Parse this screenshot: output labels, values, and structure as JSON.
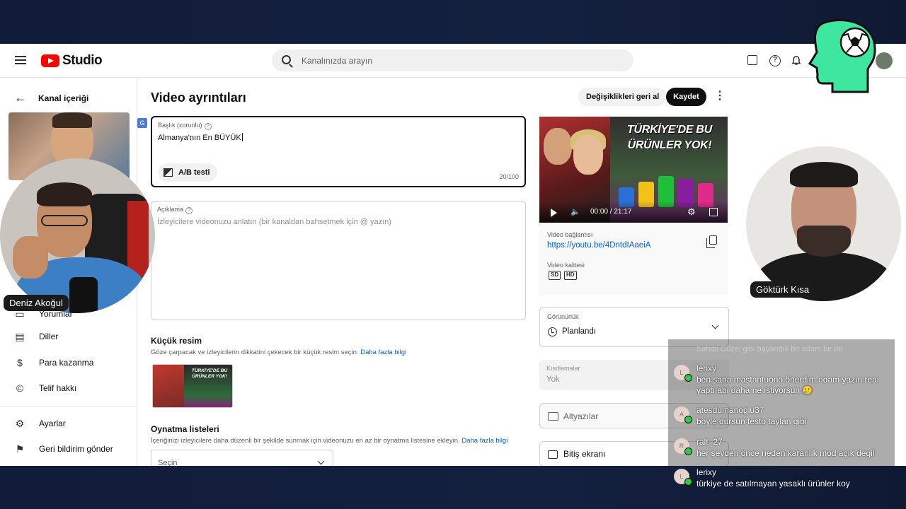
{
  "header": {
    "logo_text": "Studio",
    "search_placeholder": "Kanalınızda arayın"
  },
  "sidebar": {
    "back_label": "Kanal içeriği",
    "items": [
      {
        "label": "Yorumlar",
        "icon": "comments-icon"
      },
      {
        "label": "Diller",
        "icon": "subtitles-icon"
      },
      {
        "label": "Para kazanma",
        "icon": "dollar-icon"
      },
      {
        "label": "Telif hakkı",
        "icon": "copyright-icon"
      }
    ],
    "bottom_items": [
      {
        "label": "Ayarlar",
        "icon": "gear-icon"
      },
      {
        "label": "Geri bildirim gönder",
        "icon": "feedback-icon"
      }
    ]
  },
  "main": {
    "page_title": "Video ayrıntıları",
    "undo_label": "Değişiklikleri geri al",
    "save_label": "Kaydet",
    "title_field": {
      "label": "Başlık (zorunlu)",
      "value": "Almanya'nın En BÜYÜK",
      "counter": "20/100",
      "ab_test_label": "A/B testi"
    },
    "description_field": {
      "label": "Açıklama",
      "placeholder": "İzleyicilere videonuzu anlatın (bir kanaldan bahsetmek için @ yazın)"
    },
    "thumbnail": {
      "title": "Küçük resim",
      "subtitle": "Göze çarpacak ve izleyicilerin dikkatini çekecek bir küçük resim seçin.",
      "link": "Daha fazla bilgi",
      "thumb_text": "TÜRKİYE'DE BU ÜRÜNLER YOK!"
    },
    "playlists": {
      "title": "Oynatma listeleri",
      "subtitle": "İçeriğinizi izleyicilere daha düzenli bir şekilde sunmak için videonuzu en az bir oynatma listesine ekleyin.",
      "link": "Daha fazla bilgi",
      "select_value": "Seçin"
    }
  },
  "right_panel": {
    "preview_text": "TÜRKİYE'DE BU ÜRÜNLER YOK!",
    "time": "00:00 / 21:17",
    "video_link_label": "Video bağlantısı",
    "video_link": "https://youtu.be/4DntdIAaeiA",
    "quality_label": "Video kalitesi",
    "quality_badges": [
      "SD",
      "HD"
    ],
    "visibility_label": "Görünürlük",
    "visibility_value": "Planlandı",
    "restrictions_label": "Kısıtlamalar",
    "restrictions_value": "Yok",
    "subtitles_label": "Altyazılar",
    "end_screen_label": "Bitiş ekranı"
  },
  "overlay": {
    "left_cam_name": "Deniz Akoğul",
    "right_cam_name": "Göktürk Kısa",
    "logo_color": "#3ee6a0",
    "chat_ghost": "Sahibi Güzel gibi bayandık bir adam bir mi",
    "chat": [
      {
        "initial": "L",
        "user": "lerixy",
        "text": "ben sana mastantuono önerdim adam yazın real yaptı abi daha ne istiyorsun 🥲"
      },
      {
        "initial": "A",
        "user": "atesdumanoglu37",
        "text": "böyle dursun testo taylan gibi"
      },
      {
        "initial": "R",
        "user": "ralt_27",
        "text": "her şeyden önce neden karanlık mod açık degil"
      },
      {
        "initial": "L",
        "user": "lerixy",
        "text": "türkiye de satılmayan yasaklı ürünler koy"
      }
    ]
  }
}
